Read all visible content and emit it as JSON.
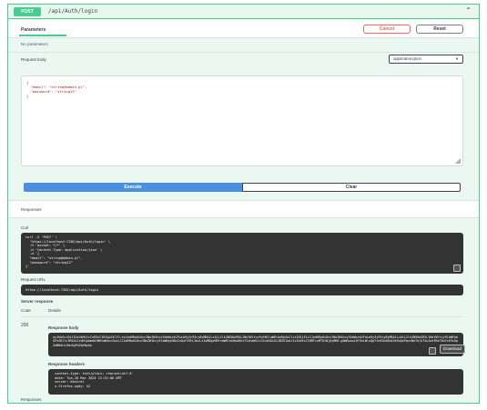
{
  "operation": {
    "method": "POST",
    "path": "/api/Auth/login"
  },
  "parameters": {
    "tab_label": "Parameters",
    "cancel_label": "Cancel",
    "reset_label": "Reset",
    "no_params_text": "No parameters"
  },
  "request_body": {
    "label": "Request body",
    "content_type": "application/json",
    "json_lines": [
      "{",
      "  \"email\": \"string@admin.pl\",",
      "  \"password\": \"string12\"",
      "}"
    ]
  },
  "actions": {
    "execute_label": "Execute",
    "clear_label": "Clear"
  },
  "responses": {
    "header_label": "Responses",
    "curl_label": "Curl",
    "curl_lines": [
      "curl -X 'POST' \\",
      "  'https://localhost:7202/api/Auth/login' \\",
      "  -H 'accept: */*' \\",
      "  -H 'Content-Type: application/json' \\",
      "  -d '{",
      "  \"email\": \"string@admin.pl\",",
      "  \"password\": \"string12\"",
      "}'"
    ],
    "request_url_label": "Request URL",
    "request_url": "https://localhost:7202/api/Auth/login",
    "server_response_label": "Server response",
    "col_code": "Code",
    "col_details": "Details",
    "status_code": "200",
    "response_body_label": "Response body",
    "response_body": "eyJhbGciOiJIUzUxMiIsInR5cCI6IkpXVCJ9.eyJodHRwOi8vc2NoZW1hcy54bWxzb2FwLm9yZy93cy8yMDA1LzA1L2lkZW50aXR5L2NsYWltcy9uYW1laWRlbnRpZmllciI6IjEiLCJodHRwOi8vc2NoZW1hcy54bWxzb2FwLm9yZy93cy8yMDA1LzA1L2lkZW50aXR5L2NsYWltcy9lbWFpbGFkZHJlc3MiOiJzdHJpbmdAYWRtaW4ucGwiLCJodHRwOi8vc2NoZW1hcy5taWNyb3NvZnQuY29tL3dzLzIwMDgvMDYvaWRlbnRpdHkvY2xhaW1zL3JvbGUiOiJBZG1pbiIsImV4cCI6MTcxMTQ1NjQyMH0.g0mRwcwLQf9sLWlxQpYtn0ShdEm4Xk9wQxPqvzNk7bjGf2w1oV3RsT8uYcE5iKpZaM6dLhJ0nXgFb2QeWyAo",
    "download_label": "Download",
    "response_headers_label": "Response headers",
    "response_headers_lines": [
      " content-type: text/plain; charset=utf-8",
      " date: Tue,26 Mar 2024 11:31:00 GMT",
      " server: Kestrel",
      " x-firefox-spdy: h2"
    ],
    "footer_label": "Responses"
  },
  "colors": {
    "post_green": "#49cc90",
    "execute_blue": "#4990e2",
    "cancel_red": "#ff6060",
    "code_bg": "#333333"
  }
}
